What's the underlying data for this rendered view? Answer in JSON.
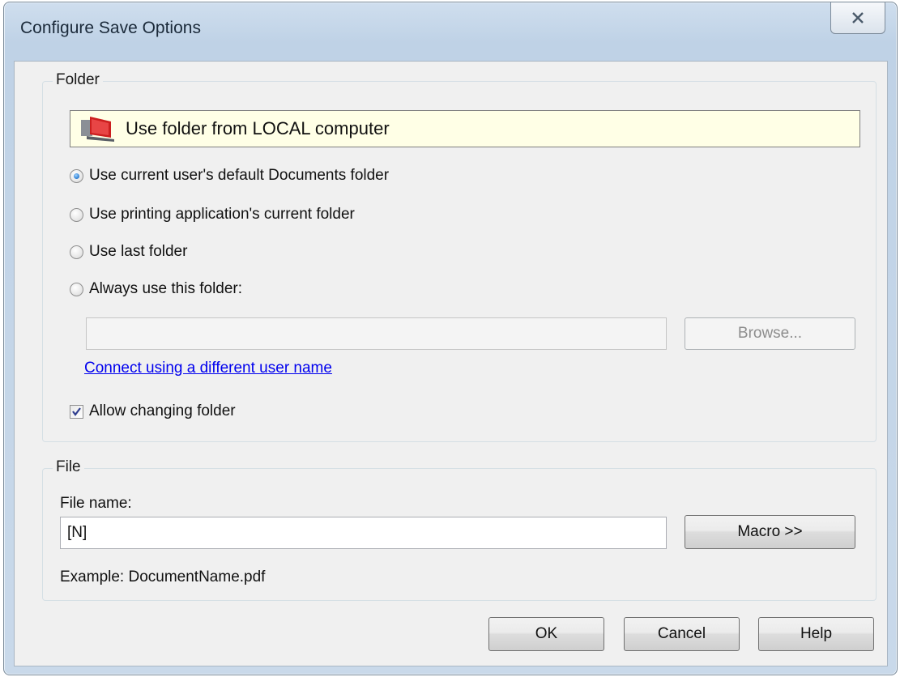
{
  "window": {
    "title": "Configure Save Options"
  },
  "folder": {
    "group_label": "Folder",
    "banner_text": "Use folder from LOCAL computer",
    "options": [
      {
        "label": "Use current user's default Documents folder",
        "checked": true
      },
      {
        "label": "Use printing application's current folder",
        "checked": false
      },
      {
        "label": "Use last folder",
        "checked": false
      },
      {
        "label": "Always use this folder:",
        "checked": false
      }
    ],
    "path_value": "",
    "browse_label": "Browse...",
    "connect_link": "Connect using a different user name",
    "allow_changing_label": "Allow changing folder",
    "allow_changing_checked": true
  },
  "file": {
    "group_label": "File",
    "name_label": "File name:",
    "name_value": "[N]",
    "macro_label": "Macro >>",
    "example_text": "Example: DocumentName.pdf"
  },
  "buttons": {
    "ok": "OK",
    "cancel": "Cancel",
    "help": "Help"
  },
  "icons": {
    "close": "close-icon",
    "computer": "computer-icon"
  }
}
